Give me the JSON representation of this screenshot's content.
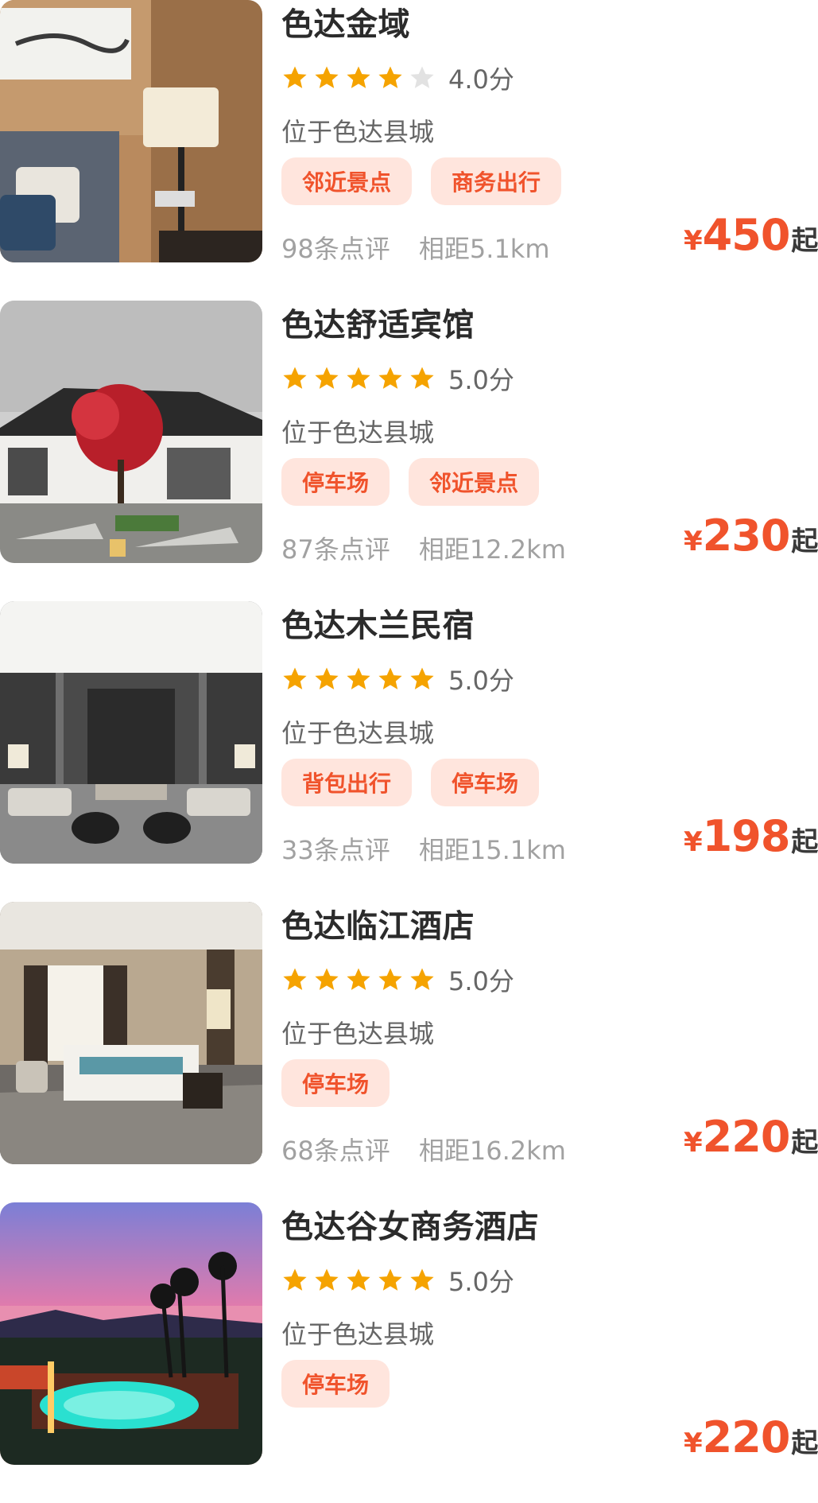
{
  "hotels": [
    {
      "name": "色达金域",
      "rating": 4,
      "score": "4.0分",
      "location": "位于色达县城",
      "tags": [
        "邻近景点",
        "商务出行"
      ],
      "reviews": "98条点评",
      "distance": "相距5.1km",
      "currency": "¥",
      "price": "450",
      "price_suffix": "起"
    },
    {
      "name": "色达舒适宾馆",
      "rating": 5,
      "score": "5.0分",
      "location": "位于色达县城",
      "tags": [
        "停车场",
        "邻近景点"
      ],
      "reviews": "87条点评",
      "distance": "相距12.2km",
      "currency": "¥",
      "price": "230",
      "price_suffix": "起"
    },
    {
      "name": "色达木兰民宿",
      "rating": 5,
      "score": "5.0分",
      "location": "位于色达县城",
      "tags": [
        "背包出行",
        "停车场"
      ],
      "reviews": "33条点评",
      "distance": "相距15.1km",
      "currency": "¥",
      "price": "198",
      "price_suffix": "起"
    },
    {
      "name": "色达临江酒店",
      "rating": 5,
      "score": "5.0分",
      "location": "位于色达县城",
      "tags": [
        "停车场"
      ],
      "reviews": "68条点评",
      "distance": "相距16.2km",
      "currency": "¥",
      "price": "220",
      "price_suffix": "起"
    },
    {
      "name": "色达谷女商务酒店",
      "rating": 5,
      "score": "5.0分",
      "location": "位于色达县城",
      "tags": [
        "停车场"
      ],
      "reviews": "",
      "distance": "",
      "currency": "¥",
      "price": "220",
      "price_suffix": "起"
    }
  ],
  "colors": {
    "accent": "#f0532c",
    "tag_bg": "#ffe5dd",
    "star_on": "#f5a300",
    "star_off": "#e2e2e2",
    "muted_text": "#a1a1a1",
    "secondary_text": "#666666"
  },
  "icons": {
    "star": "star-icon"
  }
}
